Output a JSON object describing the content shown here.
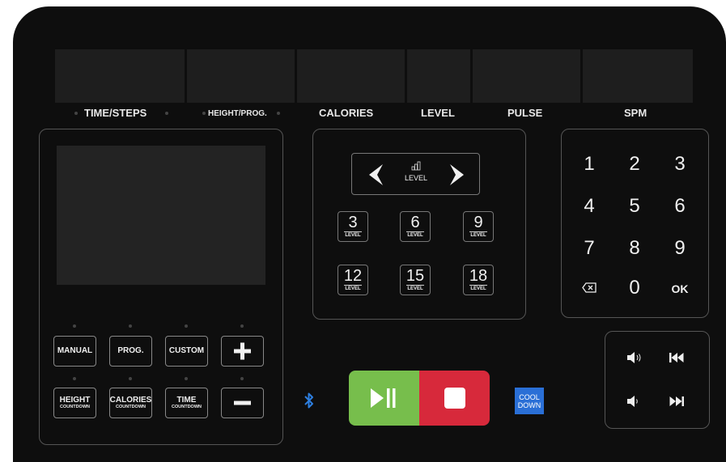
{
  "display_labels": {
    "time_steps": "TIME/STEPS",
    "height_prog": "HEIGHT/PROG.",
    "calories": "CALORIES",
    "level": "LEVEL",
    "pulse": "PULSE",
    "spm": "SPM"
  },
  "program_buttons": {
    "manual": "MANUAL",
    "prog": "PROG.",
    "custom": "CUSTOM",
    "height_main": "HEIGHT",
    "height_sub": "COUNTDOWN",
    "calories_main": "CALORIES",
    "calories_sub": "COUNTDOWN",
    "time_main": "TIME",
    "time_sub": "COUNTDOWN"
  },
  "level_panel": {
    "nav_label": "LEVEL",
    "unit": "LEVEL",
    "keys": [
      "3",
      "6",
      "9",
      "12",
      "15",
      "18"
    ]
  },
  "keypad": {
    "keys": [
      "1",
      "2",
      "3",
      "4",
      "5",
      "6",
      "7",
      "8",
      "9",
      "0"
    ],
    "ok": "OK"
  },
  "cool_down": {
    "line1": "COOL",
    "line2": "DOWN"
  },
  "colors": {
    "start_pause": "#77be4c",
    "stop": "#d7293b",
    "cool_down": "#2a6fd6",
    "bluetooth": "#2d7fe0"
  }
}
